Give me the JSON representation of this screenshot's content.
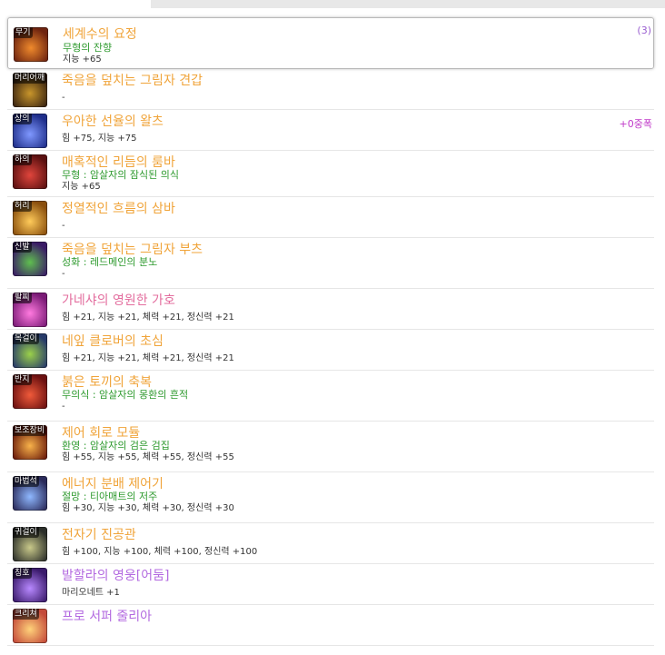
{
  "items": [
    {
      "slot": "무기",
      "name": "세계수의 요정",
      "potential": "무형의 잔향",
      "stats": "지능 +65",
      "count": "(3)",
      "name_color": "orange",
      "icon_colors": [
        "#f08a2c",
        "#6e2410"
      ]
    },
    {
      "slot": "머리어깨",
      "name": "죽음을 덮치는 그림자 견갑",
      "potential": "",
      "stats": "-",
      "name_color": "orange",
      "icon_colors": [
        "#c8952b",
        "#3a2410"
      ]
    },
    {
      "slot": "상의",
      "name": "우아한 선율의 왈츠",
      "potential": "",
      "stats": "힘 +75, 지능 +75",
      "stars": "+0중폭",
      "name_color": "orange",
      "icon_colors": [
        "#7f98ff",
        "#1f2e8a"
      ]
    },
    {
      "slot": "하의",
      "name": "매혹적인 리듬의 룸바",
      "potential": "무형 : 암살자의 잠식된 의식",
      "stats": "지능 +65",
      "name_color": "orange",
      "icon_colors": [
        "#e0453c",
        "#5a1010"
      ]
    },
    {
      "slot": "허리",
      "name": "정열적인 흐름의 삼바",
      "potential": "",
      "stats": "-",
      "name_color": "orange",
      "icon_colors": [
        "#ffcb5a",
        "#8a4f0d"
      ]
    },
    {
      "slot": "신발",
      "name": "죽음을 덮치는 그림자 부츠",
      "potential": "성화 : 레드메인의 분노",
      "stats": "-",
      "name_color": "orange",
      "icon_colors": [
        "#5fbf4f",
        "#3a1b66"
      ]
    },
    {
      "slot": "팔찌",
      "name": "가네샤의 영원한 가호",
      "potential": "",
      "stats": "힘 +21, 지능 +21, 체력 +21, 정신력 +21",
      "name_color": "pink",
      "icon_colors": [
        "#ff7adf",
        "#7a1a76"
      ]
    },
    {
      "slot": "목걸이",
      "name": "네잎 클로버의 초심",
      "potential": "",
      "stats": "힘 +21, 지능 +21, 체력 +21, 정신력 +21",
      "name_color": "orange",
      "icon_colors": [
        "#9bd14a",
        "#273a69"
      ]
    },
    {
      "slot": "반지",
      "name": "붉은 토끼의 축복",
      "potential": "무의식 : 암살자의 몽환의 흔적",
      "stats": "-",
      "name_color": "orange",
      "icon_colors": [
        "#f05a3a",
        "#6b1010"
      ]
    },
    {
      "slot": "보조장비",
      "name": "제어 회로 모듈",
      "potential": "환영 : 암살자의 검은 검집",
      "stats": "힘 +55, 지능 +55, 체력 +55, 정신력 +55",
      "name_color": "orange",
      "icon_colors": [
        "#f8b24a",
        "#6a1a0a"
      ]
    },
    {
      "slot": "마법석",
      "name": "에너지 분배 제어기",
      "potential": "절망 : 티아매트의 저주",
      "stats": "힘 +30, 지능 +30, 체력 +30, 정신력 +30",
      "name_color": "orange",
      "icon_colors": [
        "#8fb8ff",
        "#2a2a5a"
      ]
    },
    {
      "slot": "귀걸이",
      "name": "전자기 진공관",
      "potential": "",
      "stats": "힘 +100, 지능 +100, 체력 +100, 정신력 +100",
      "name_color": "orange",
      "icon_colors": [
        "#c9c98a",
        "#2c2f2a"
      ]
    },
    {
      "slot": "칭호",
      "name": "발할라의 영웅[어둠]",
      "potential": "",
      "stats": "마리오네트 +1",
      "name_color": "purple",
      "icon_colors": [
        "#b889ff",
        "#3a1a6b"
      ]
    },
    {
      "slot": "크리쳐",
      "name": "프로 서퍼 줄리아",
      "potential": "",
      "stats": "",
      "name_color": "purple",
      "icon_colors": [
        "#ffd27a",
        "#c44a3a"
      ]
    }
  ]
}
